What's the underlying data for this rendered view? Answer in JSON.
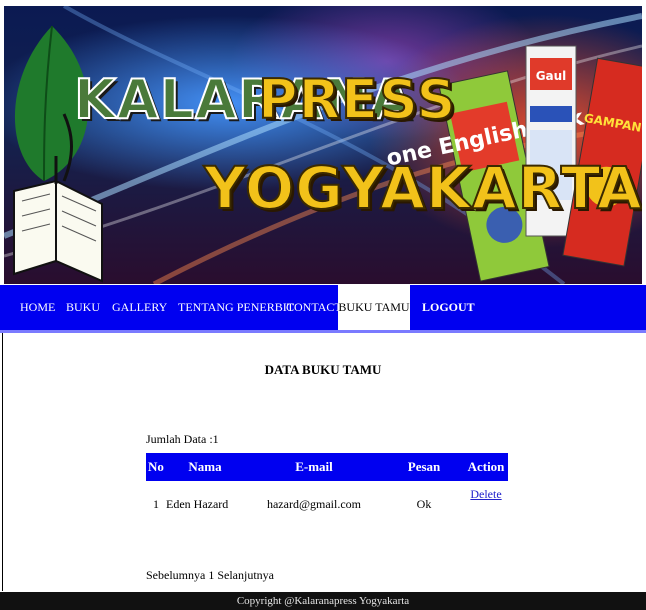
{
  "banner": {
    "brand_line1_left": "KALARANA",
    "brand_line1_right": "PRESS",
    "brand_line2": "YOGYAKARTA",
    "book1_title": "one English Talk",
    "book2_title": "Gaul",
    "book3_title": "GAMPANG"
  },
  "nav": {
    "items": [
      {
        "label": "HOME"
      },
      {
        "label": "BUKU"
      },
      {
        "label": "GALLERY"
      },
      {
        "label": "TENTANG PENERBIT"
      },
      {
        "label": "CONTACT"
      },
      {
        "label": "BUKU TAMU"
      },
      {
        "label": "LOGOUT"
      }
    ],
    "active": "BUKU TAMU"
  },
  "main": {
    "title": "DATA BUKU TAMU",
    "count_text": "Jumlah Data :1",
    "table": {
      "headers": [
        "No",
        "Nama",
        "E-mail",
        "Pesan",
        "Action"
      ],
      "rows": [
        {
          "no": "1",
          "nama": "Eden Hazard",
          "email": "hazard@gmail.com",
          "pesan": "Ok",
          "action": "Delete"
        }
      ]
    },
    "pagination_text": "Sebelumnya 1 Selanjutnya"
  },
  "footer": {
    "text": "Copyright @Kalaranapress Yogyakarta"
  },
  "colors": {
    "nav_bg": "#0000f0",
    "table_header_bg": "#0000f0",
    "footer_bg": "#111111",
    "link": "#2222cc"
  }
}
